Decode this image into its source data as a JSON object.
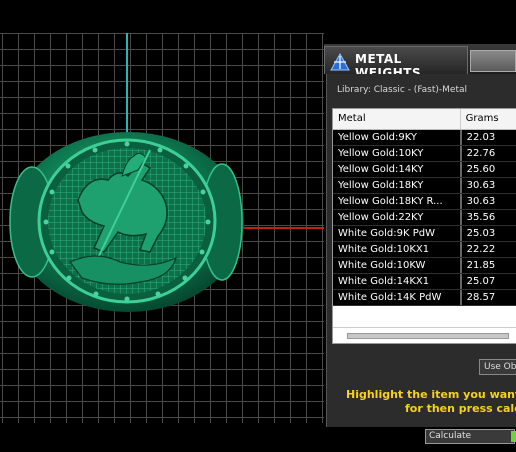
{
  "panel": {
    "title": "METAL WEIGHTS",
    "library_label": "Library: Classic - (Fast)-Metal",
    "table": {
      "headers": {
        "metal": "Metal",
        "grams": "Grams"
      },
      "rows": [
        {
          "metal": "Yellow Gold:9KY",
          "grams": "22.03"
        },
        {
          "metal": "Yellow Gold:10KY",
          "grams": "22.76"
        },
        {
          "metal": "Yellow Gold:14KY",
          "grams": "25.60"
        },
        {
          "metal": "Yellow Gold:18KY",
          "grams": "30.63"
        },
        {
          "metal": "Yellow Gold:18KY R...",
          "grams": "30.63"
        },
        {
          "metal": "Yellow Gold:22KY",
          "grams": "35.56"
        },
        {
          "metal": "White Gold:9K PdW",
          "grams": "25.03"
        },
        {
          "metal": "White Gold:10KX1",
          "grams": "22.22"
        },
        {
          "metal": "White Gold:10KW",
          "grams": "21.85"
        },
        {
          "metal": "White Gold:14KX1",
          "grams": "25.07"
        },
        {
          "metal": "White Gold:14K PdW",
          "grams": "28.57"
        }
      ]
    },
    "use_button_label": "Use Ob",
    "hint_line1": "Highlight the item you want to",
    "hint_line2": "for then press calcu",
    "calculate_label": "Calculate"
  },
  "colors": {
    "ring": "#0f8a5c",
    "hint": "#f7d21a",
    "axis_vertical": "#2bb5b5",
    "axis_horizontal": "#c0200f"
  }
}
